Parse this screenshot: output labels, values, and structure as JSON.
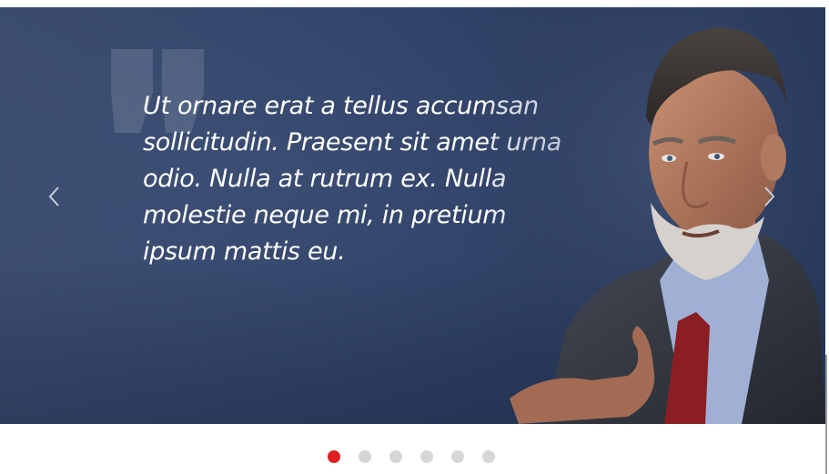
{
  "testimonial": {
    "quote": "Ut ornare erat a tellus accumsan sollicitudin. Praesent sit amet urna odio. Nulla at rutrum ex. Nulla molestie neque mi, in pretium ipsum mattis eu."
  },
  "navigation": {
    "prev_icon": "chevron-left-icon",
    "next_icon": "chevron-right-icon"
  },
  "pagination": {
    "total": 6,
    "active_index": 0
  },
  "colors": {
    "slide_background": "#33456a",
    "quote_text": "#ffffff",
    "active_dot": "#e02020",
    "inactive_dot": "#d6d6d6"
  }
}
